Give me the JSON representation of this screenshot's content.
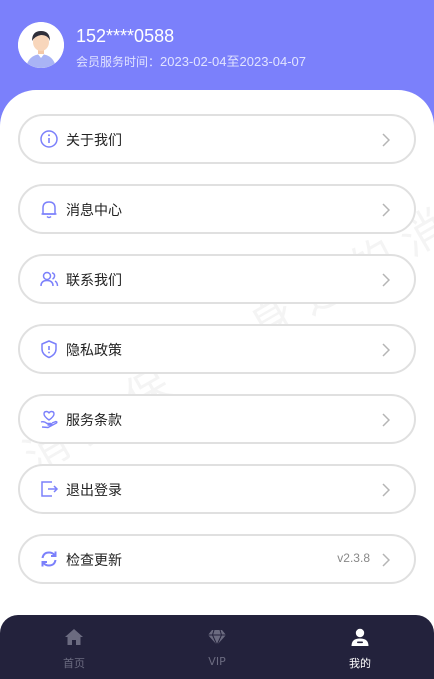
{
  "profile": {
    "phone": "152****0588",
    "membership_label": "会员服务时间：",
    "membership_range": "2023-02-04至2023-04-07"
  },
  "watermark": "消费保 您身边的消",
  "menu": [
    {
      "label": "关于我们",
      "icon": "info-icon"
    },
    {
      "label": "消息中心",
      "icon": "bell-icon"
    },
    {
      "label": "联系我们",
      "icon": "contacts-icon"
    },
    {
      "label": "隐私政策",
      "icon": "shield-icon"
    },
    {
      "label": "服务条款",
      "icon": "heart-hand-icon"
    },
    {
      "label": "退出登录",
      "icon": "logout-icon"
    },
    {
      "label": "检查更新",
      "icon": "refresh-icon",
      "value": "v2.3.8"
    }
  ],
  "tabs": [
    {
      "label": "首页",
      "icon": "home-icon",
      "active": false
    },
    {
      "label": "VIP",
      "icon": "diamond-icon",
      "active": false
    },
    {
      "label": "我的",
      "icon": "user-icon",
      "active": true
    }
  ],
  "colors": {
    "accent": "#7b80fb",
    "tabbar": "#23223c",
    "border": "#e0e0e0"
  }
}
